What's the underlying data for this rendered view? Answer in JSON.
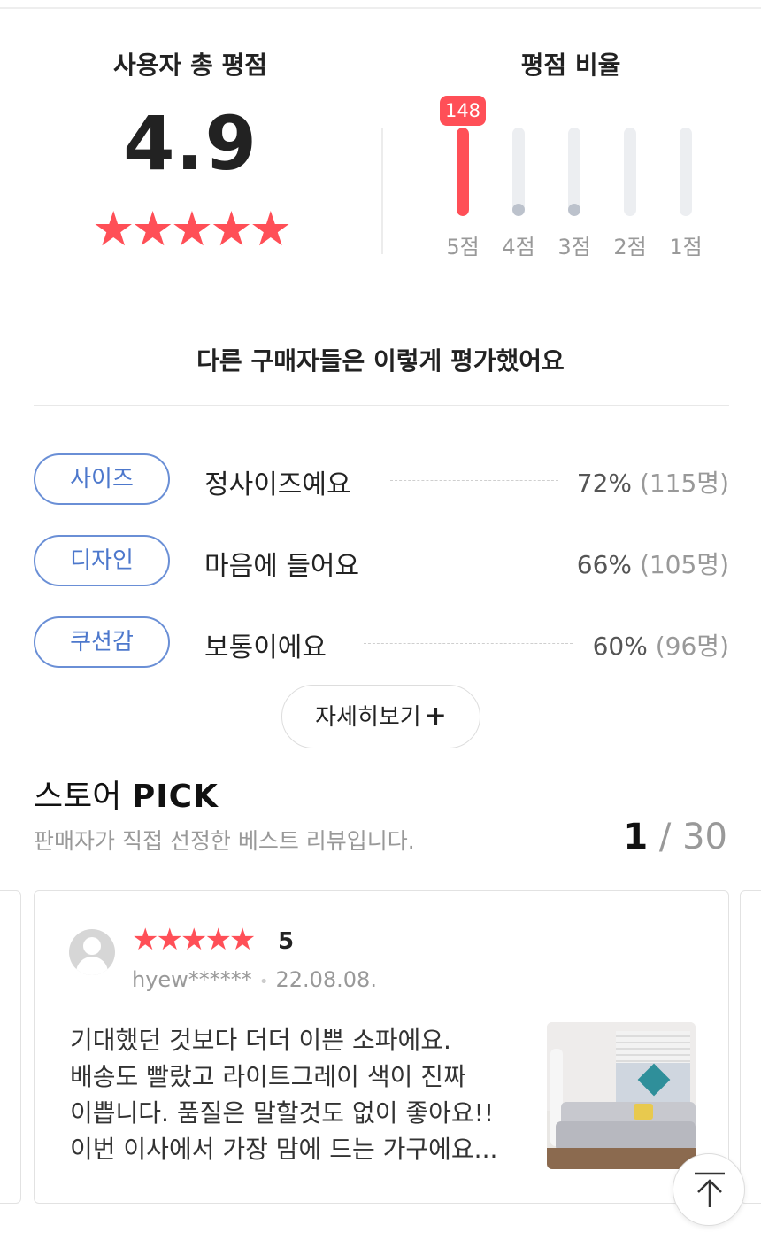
{
  "summary": {
    "total_title": "사용자 총 평점",
    "total_score": "4.9",
    "total_stars": "★★★★★",
    "ratio_title": "평점 비율",
    "top_count_badge": "148",
    "bars": [
      {
        "label": "5점",
        "fraction": 1.0
      },
      {
        "label": "4점",
        "fraction": 0.08
      },
      {
        "label": "3점",
        "fraction": 0.08
      },
      {
        "label": "2점",
        "fraction": 0.0
      },
      {
        "label": "1점",
        "fraction": 0.0
      }
    ]
  },
  "evaluation": {
    "title": "다른 구매자들은 이렇게 평가했어요",
    "items": [
      {
        "tag": "사이즈",
        "text": "정사이즈예요",
        "percent": "72%",
        "count": "(115명)"
      },
      {
        "tag": "디자인",
        "text": "마음에 들어요",
        "percent": "66%",
        "count": "(105명)"
      },
      {
        "tag": "쿠션감",
        "text": "보통이에요",
        "percent": "60%",
        "count": "(96명)"
      }
    ],
    "more_label": "자세히보기",
    "more_icon": "+"
  },
  "store_pick": {
    "title_prefix": "스토어",
    "title_strong": "PICK",
    "subtitle": "판매자가 직접 선정한 베스트 리뷰입니다.",
    "pager_current": "1",
    "pager_sep": "/",
    "pager_total": "30"
  },
  "review": {
    "stars": "★★★★★",
    "score": "5",
    "user": "hyew******",
    "date_sep": "•",
    "date": "22.08.08.",
    "lines": [
      "기대했던 것보다 더더 이쁜 소파에요.",
      "배송도 빨랐고 라이트그레이 색이 진짜",
      "이쁩니다. 품질은 말할것도 없이 좋아요!!",
      "이번 이사에서 가장 맘에 드는 가구에요..."
    ],
    "photo_icon": "sofa-photo"
  },
  "colors": {
    "accent_red": "#ff4f57",
    "tag_blue": "#4d78cc",
    "muted_gray": "#999999"
  }
}
